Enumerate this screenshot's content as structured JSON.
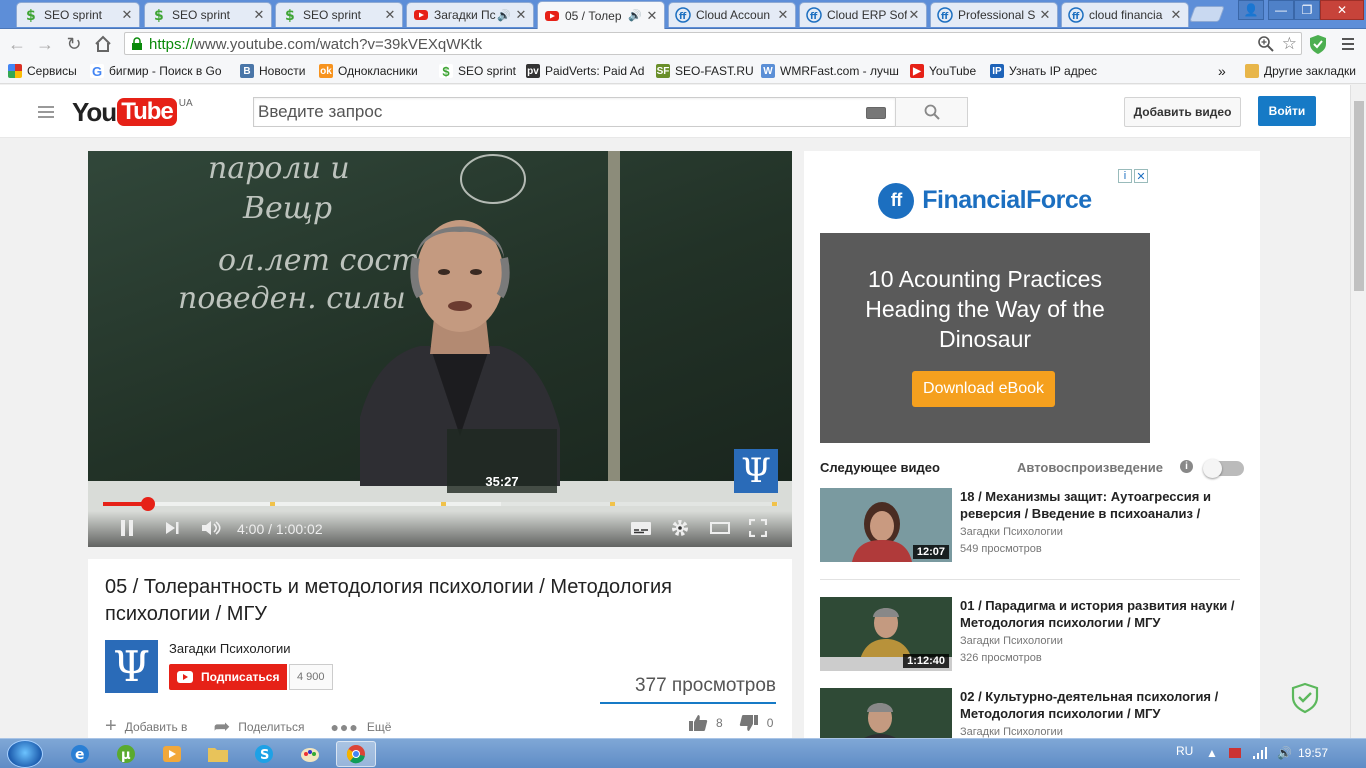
{
  "browser": {
    "tabs": [
      {
        "title": "SEO sprint",
        "icon": "seosprint-icon",
        "active": false,
        "audio": false
      },
      {
        "title": "SEO sprint",
        "icon": "seosprint-icon",
        "active": false,
        "audio": false
      },
      {
        "title": "SEO sprint",
        "icon": "seosprint-icon",
        "active": false,
        "audio": false
      },
      {
        "title": "Загадки Пс",
        "icon": "youtube-icon",
        "active": false,
        "audio": true
      },
      {
        "title": "05 / Толер",
        "icon": "youtube-icon",
        "active": true,
        "audio": true
      },
      {
        "title": "Cloud Accoun",
        "icon": "financialforce-icon",
        "active": false,
        "audio": false
      },
      {
        "title": "Cloud ERP Sof",
        "icon": "financialforce-icon",
        "active": false,
        "audio": false
      },
      {
        "title": "Professional S",
        "icon": "financialforce-icon",
        "active": false,
        "audio": false
      },
      {
        "title": "cloud financia",
        "icon": "financialforce-icon",
        "active": false,
        "audio": false
      }
    ],
    "url_scheme": "https://",
    "url_host": "www.youtube.com",
    "url_path": "/watch?v=39kVEXqWKtk",
    "bookmarks": [
      {
        "label": "Сервисы",
        "icon": "apps-icon",
        "color": "#d93025"
      },
      {
        "label": "бигмир - Поиск в Go",
        "icon": "google-icon",
        "color": "#4285f4"
      },
      {
        "label": "Новости",
        "icon": "vk-icon",
        "color": "#4a76a8"
      },
      {
        "label": "Однокласники",
        "icon": "ok-icon",
        "color": "#f7931e"
      },
      {
        "label": "SEO sprint",
        "icon": "seosprint-icon",
        "color": "#3fa535"
      },
      {
        "label": "PaidVerts: Paid Ad",
        "icon": "paidverts-icon",
        "color": "#333333"
      },
      {
        "label": "SEO-FAST.RU",
        "icon": "seofast-icon",
        "color": "#6a8f2a"
      },
      {
        "label": "WMRFast.com - лучш",
        "icon": "wmrfast-icon",
        "color": "#5b8fd6"
      },
      {
        "label": "YouTube",
        "icon": "youtube-icon",
        "color": "#e62117"
      },
      {
        "label": "Узнать IP адрес",
        "icon": "ip-icon",
        "color": "#1e63b8"
      }
    ],
    "more_bookmarks": "»",
    "other_bookmarks": "Другие закладки"
  },
  "youtube": {
    "logo_you": "You",
    "logo_tube": "Tube",
    "region": "UA",
    "search_placeholder": "Введите запрос",
    "upload_label": "Добавить видео",
    "signin_label": "Войти"
  },
  "player": {
    "chalk": [
      "пароли и",
      "Вещр",
      "ол.лет состоян",
      "поведен. силы"
    ],
    "logo_glyph": "Ψ",
    "hover_time": "35:27",
    "current_time": "4:00",
    "duration": "1:00:02",
    "played_fraction": 0.067,
    "buffered_fraction": 0.59,
    "accent": "#e62117"
  },
  "video": {
    "title": "05 / Толерантность и методология психологии / Методология психологии / МГУ",
    "channel": "Загадки Психологии",
    "channel_glyph": "Ψ",
    "subscribe_label": "Подписаться",
    "subscribers": "4 900",
    "views": "377 просмотров",
    "actions": [
      {
        "label": "Добавить в",
        "icon": "plus-icon"
      },
      {
        "label": "Поделиться",
        "icon": "share-icon"
      },
      {
        "label": "Ещё",
        "icon": "more-icon"
      }
    ],
    "likes": "8",
    "dislikes": "0"
  },
  "ad": {
    "brand": "FinancialForce",
    "headline": "10 Acounting Practices Heading the Way of the Dinosaur",
    "cta": "Download eBook"
  },
  "sidebar": {
    "next_label": "Следующее видео",
    "autoplay_label": "Автовоспроизведение",
    "autoplay_on": false,
    "videos": [
      {
        "title": "18 / Механизмы защит: Аутоагрессия и реверсия / Введение в психоанализ /",
        "channel": "Загадки Психологии",
        "views": "549 просмотров",
        "duration": "12:07"
      },
      {
        "title": "01 / Парадигма и история развития науки / Методология психологии / МГУ",
        "channel": "Загадки Психологии",
        "views": "326 просмотров",
        "duration": "1:12:40"
      },
      {
        "title": "02 / Культурно-деятельная психология / Методология психологии / МГУ",
        "channel": "Загадки Психологии",
        "views": "",
        "duration": ""
      }
    ]
  },
  "taskbar": {
    "lang": "RU",
    "clock": "19:57",
    "apps": [
      "ie-icon",
      "utorrent-icon",
      "media-player-icon",
      "explorer-icon",
      "skype-icon",
      "paint-icon",
      "chrome-icon"
    ]
  }
}
